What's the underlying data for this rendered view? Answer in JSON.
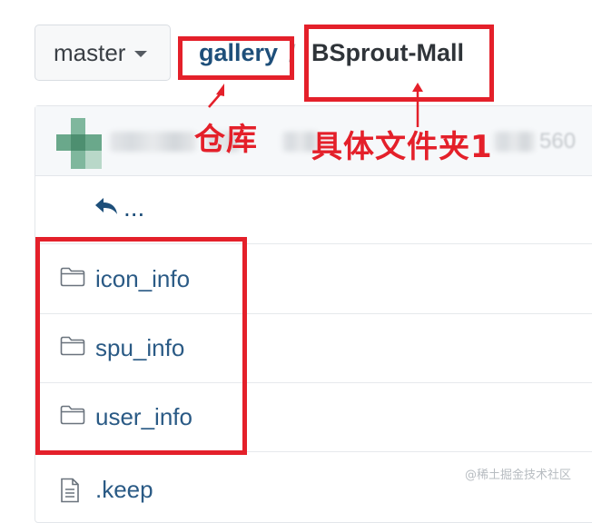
{
  "branch": {
    "name": "master",
    "caret_icon": "caret-down-icon"
  },
  "breadcrumb": {
    "repo": "gallery",
    "separator": "/",
    "folder": "BSprout-Mall"
  },
  "annotations": {
    "repo_label": "仓库",
    "folder_label": "具体文件夹1",
    "color": "#e4202a"
  },
  "commit_header": {
    "count_blurred": "560"
  },
  "files": {
    "up": {
      "label": "...",
      "icon": "back-arrow-icon"
    },
    "folders": [
      {
        "name": "icon_info",
        "icon": "folder-icon"
      },
      {
        "name": "spu_info",
        "icon": "folder-icon"
      },
      {
        "name": "user_info",
        "icon": "folder-icon"
      }
    ],
    "file": {
      "name": ".keep",
      "icon": "file-icon"
    }
  },
  "watermark": "@稀土掘金技术社区"
}
